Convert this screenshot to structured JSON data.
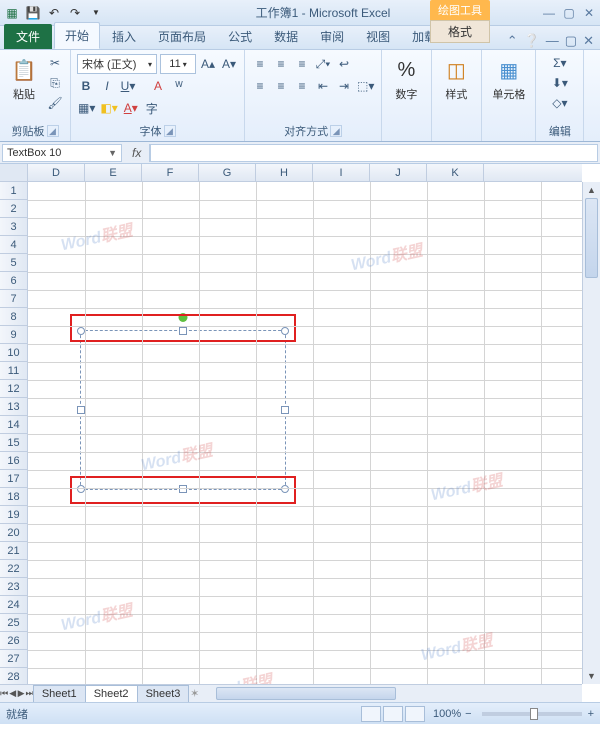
{
  "titlebar": {
    "title": "工作簿1 - Microsoft Excel",
    "context_group": "绘图工具",
    "context_tab": "格式"
  },
  "tabs": {
    "file": "文件",
    "home": "开始",
    "insert": "插入",
    "layout": "页面布局",
    "formulas": "公式",
    "data": "数据",
    "review": "审阅",
    "view": "视图",
    "addins": "加载项"
  },
  "ribbon": {
    "clipboard": {
      "label": "剪贴板",
      "paste": "粘贴"
    },
    "font": {
      "label": "字体",
      "name": "宋体 (正文)",
      "size": "11"
    },
    "align": {
      "label": "对齐方式"
    },
    "number": {
      "label": "数字",
      "btn": "数字"
    },
    "styles": {
      "label": "样式",
      "btn": "样式"
    },
    "cells": {
      "label": "单元格",
      "btn": "单元格"
    },
    "editing": {
      "label": "编辑"
    }
  },
  "namebox": "TextBox 10",
  "columns": [
    "D",
    "E",
    "F",
    "G",
    "H",
    "I",
    "J",
    "K"
  ],
  "rows": [
    "1",
    "2",
    "3",
    "4",
    "5",
    "6",
    "7",
    "8",
    "9",
    "10",
    "11",
    "12",
    "13",
    "14",
    "15",
    "16",
    "17",
    "18",
    "19",
    "20",
    "21",
    "22",
    "23",
    "24",
    "25",
    "26",
    "27",
    "28"
  ],
  "sheets": {
    "s1": "Sheet1",
    "s2": "Sheet2",
    "s3": "Sheet3"
  },
  "status": {
    "ready": "就绪",
    "zoom": "100%"
  },
  "watermark": {
    "blue": "Word",
    "red": "联盟"
  }
}
